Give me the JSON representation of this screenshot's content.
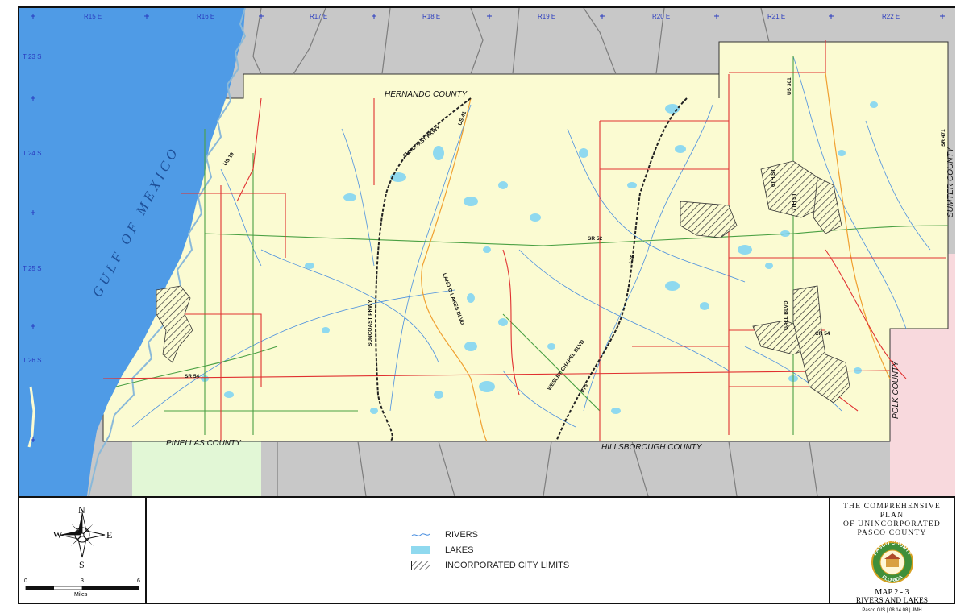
{
  "grid": {
    "ranges": [
      "R15 E",
      "R16 E",
      "R17 E",
      "R18 E",
      "R19 E",
      "R20 E",
      "R21 E",
      "R22 E"
    ],
    "townships": [
      "T 23 S",
      "T 24 S",
      "T 25 S",
      "T 26 S"
    ]
  },
  "water_labels": {
    "gulf": "GULF OF MEXICO"
  },
  "county_labels": {
    "hernando": "HERNANDO COUNTY",
    "hillsborough": "HILLSBOROUGH COUNTY",
    "pinellas": "PINELLAS COUNTY",
    "polk": "POLK COUNTY",
    "sumter": "SUMTER COUNTY"
  },
  "road_labels": {
    "us19": "US 19",
    "us41": "US 41",
    "us301": "US 301",
    "sr471": "SR 471",
    "sr52": "SR 52",
    "sr54": "SR 54",
    "cr54": "CR 54",
    "i75a": "I-75",
    "i75b": "I-75",
    "suncoast_top": "SUNCOAST PKWY",
    "suncoast_mid": "SUNCOAST PKWY",
    "land_o_lakes": "LAND O LAKES BLVD",
    "wesley_chapel": "WESLEY CHAPEL BLVD",
    "gall": "GALL BLVD",
    "st_7th": "7TH ST",
    "st_6th": "6TH ST"
  },
  "legend": {
    "rivers": "RIVERS",
    "lakes": "LAKES",
    "incorporated": "INCORPORATED CITY LIMITS"
  },
  "compass": {
    "n": "N",
    "s": "S",
    "e": "E",
    "w": "W"
  },
  "scale": {
    "start": "0",
    "mid": "3",
    "end": "6",
    "unit": "Miles"
  },
  "title_block": {
    "line1": "THE COMPREHENSIVE PLAN",
    "line2": "OF UNINCORPORATED",
    "line3": "PASCO COUNTY",
    "seal_top": "PASCO COUNTY",
    "seal_bottom": "FLORIDA",
    "map_number": "MAP 2 - 3",
    "map_title": "RIVERS AND LAKES",
    "credit": "Pasco GIS | 08.14.08 | JMH"
  },
  "colors": {
    "gulf": "#4f9be6",
    "pasco": "#fbfbd2",
    "outside": "#c8c8c8",
    "pinellas": "#e2f7d6",
    "polk": "#f8d9dd",
    "river": "#4a8fe0",
    "lake": "#8fd9ef",
    "road_red": "#e03030",
    "road_green": "#4aa043",
    "road_orange": "#f0a030",
    "grid_text": "#2a3cc0"
  }
}
